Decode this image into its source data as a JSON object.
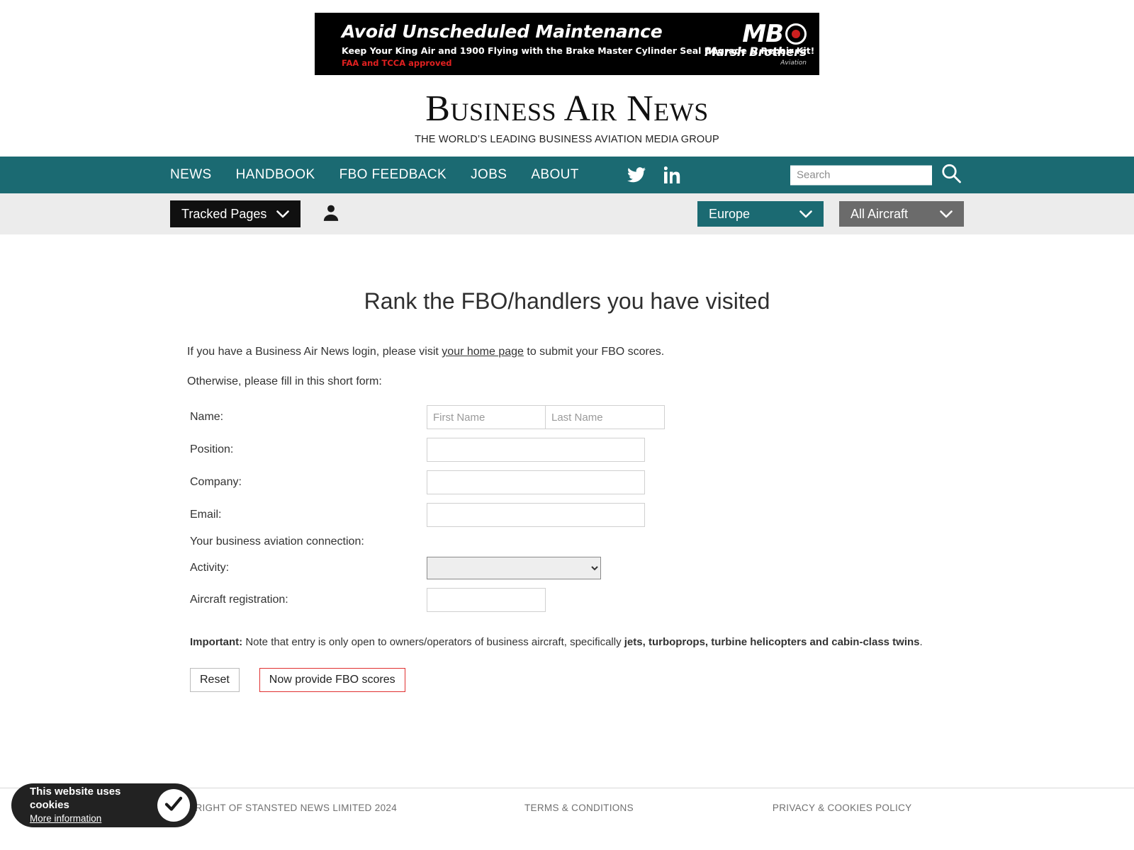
{
  "ad": {
    "headline": "Avoid Unscheduled Maintenance",
    "subline": "Keep Your King Air and 1900 Flying with the Brake Master Cylinder Seal Upgrade & Repair Kit!",
    "approved": "FAA and TCCA approved",
    "brand_initials": "MB",
    "brand_name": "Marsh Brothers",
    "brand_suffix": "Aviation"
  },
  "masthead": {
    "title": "Business Air News",
    "tagline": "THE WORLD’S LEADING BUSINESS AVIATION MEDIA GROUP"
  },
  "nav": {
    "items": [
      {
        "label": "NEWS"
      },
      {
        "label": "HANDBOOK"
      },
      {
        "label": "FBO FEEDBACK"
      },
      {
        "label": "JOBS"
      },
      {
        "label": "ABOUT"
      }
    ],
    "social": [
      {
        "name": "twitter-icon"
      },
      {
        "name": "linkedin-icon"
      }
    ],
    "search": {
      "placeholder": "Search",
      "value": "",
      "icon": "search-icon"
    }
  },
  "subbar": {
    "tracked_pages_label": "Tracked Pages",
    "account_icon": "person-icon",
    "region_select": "Europe",
    "aircraft_select": "All Aircraft"
  },
  "page": {
    "title": "Rank the FBO/handlers you have visited",
    "intro_before": "If you have a Business Air News login, please visit ",
    "intro_link": "your home page",
    "intro_after": " to submit your FBO scores.",
    "intro_second": "Otherwise, please fill in this short form:"
  },
  "form": {
    "name_label": "Name:",
    "first_name_placeholder": "First Name",
    "first_name_value": "",
    "last_name_placeholder": "Last Name",
    "last_name_value": "",
    "position_label": "Position:",
    "position_value": "",
    "company_label": "Company:",
    "company_value": "",
    "email_label": "Email:",
    "email_value": "",
    "connection_label": "Your business aviation connection:",
    "activity_label": "Activity:",
    "activity_value": "",
    "registration_label": "Aircraft registration:",
    "registration_value": "",
    "note_bold_lead": "Important:",
    "note_text": " Note that entry is only open to owners/operators of business aircraft, specifically ",
    "note_bold_tail": "jets, turboprops, turbine helicopters and cabin-class twins",
    "note_end": ".",
    "reset_label": "Reset",
    "submit_label": "Now provide FBO scores"
  },
  "footer": {
    "copyright": "COPYRIGHT OF STANSTED NEWS LIMITED 2024",
    "terms": "TERMS & CONDITIONS",
    "privacy": "PRIVACY & COOKIES POLICY"
  },
  "cookie": {
    "title": "This website uses cookies",
    "more": "More information",
    "accept_icon": "check-icon"
  },
  "colors": {
    "teal": "#1b6a72",
    "gray_pill": "#6b6b6b",
    "dark": "#101010",
    "red_border": "#e03030"
  }
}
